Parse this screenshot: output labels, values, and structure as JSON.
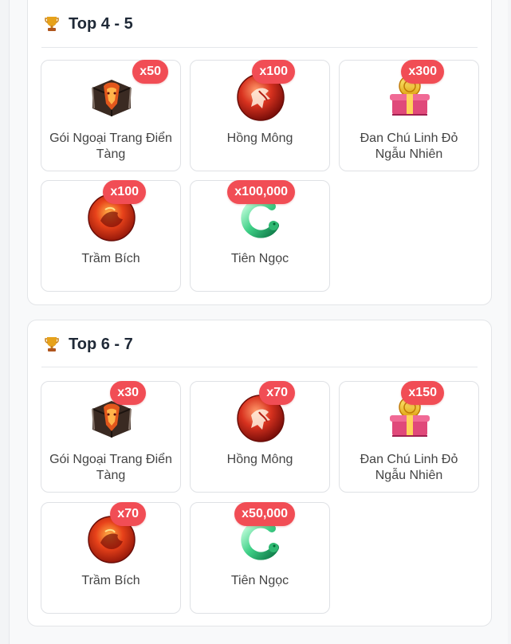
{
  "sections": [
    {
      "title": "Top 4 - 5",
      "items": [
        {
          "name": "Gói Ngoại Trang Điển Tàng",
          "qty": "x50",
          "icon": "chest-icon"
        },
        {
          "name": "Hồng Mông",
          "qty": "x100",
          "icon": "red-orb-icon"
        },
        {
          "name": "Đan Chú Linh Đỏ Ngẫu Nhiên",
          "qty": "x300",
          "icon": "gift-box-icon"
        },
        {
          "name": "Trầm Bích",
          "qty": "x100",
          "icon": "fire-orb-icon"
        },
        {
          "name": "Tiên Ngọc",
          "qty": "x100,000",
          "icon": "jade-icon"
        }
      ]
    },
    {
      "title": "Top 6 - 7",
      "items": [
        {
          "name": "Gói Ngoại Trang Điển Tàng",
          "qty": "x30",
          "icon": "chest-icon"
        },
        {
          "name": "Hồng Mông",
          "qty": "x70",
          "icon": "red-orb-icon"
        },
        {
          "name": "Đan Chú Linh Đỏ Ngẫu Nhiên",
          "qty": "x150",
          "icon": "gift-box-icon"
        },
        {
          "name": "Trầm Bích",
          "qty": "x70",
          "icon": "fire-orb-icon"
        },
        {
          "name": "Tiên Ngọc",
          "qty": "x50,000",
          "icon": "jade-icon"
        }
      ]
    }
  ],
  "colors": {
    "badge": "#f14d55",
    "card_border": "#dfe1e5"
  }
}
